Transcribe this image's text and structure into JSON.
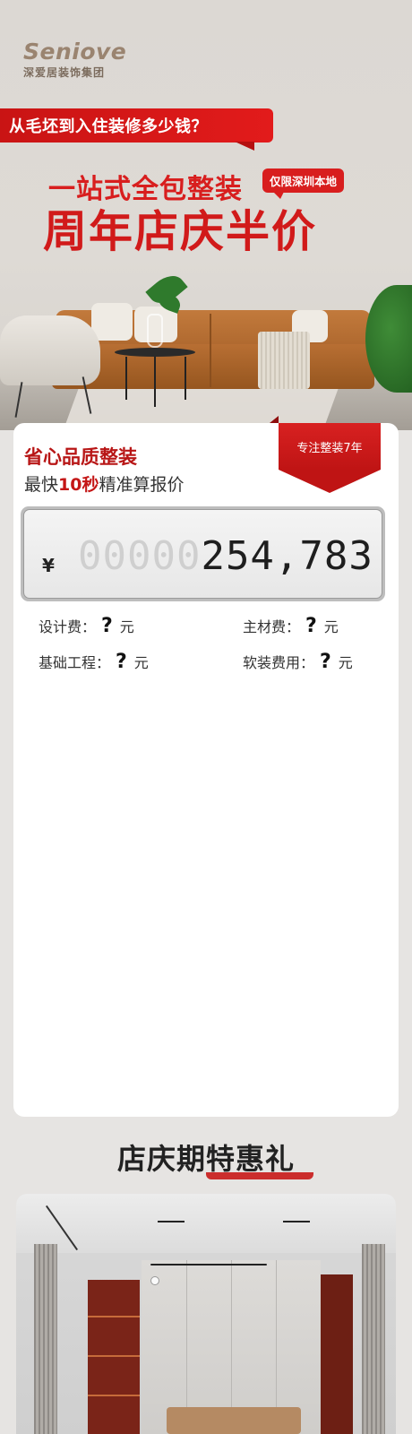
{
  "brand": {
    "name": "Seniove",
    "subtitle": "深爱居装饰集团"
  },
  "hero": {
    "question": "从毛坯到入住装修多少钱？",
    "headline_1": "一站式全包整装",
    "local_tag": "仅限深圳本地",
    "headline_2": "周年店庆半价"
  },
  "calculator": {
    "title": "省心品质整装",
    "subtitle_prefix": "最快",
    "subtitle_highlight": "10秒",
    "subtitle_suffix": "精准算报价",
    "ribbon": "专注整装7年",
    "currency": "¥",
    "placeholder_digits": "00000",
    "amount": "254,783",
    "fees": [
      {
        "label": "设计费：",
        "value": "?",
        "unit": "元"
      },
      {
        "label": "主材费：",
        "value": "?",
        "unit": "元"
      },
      {
        "label": "基础工程：",
        "value": "?",
        "unit": "元"
      },
      {
        "label": "软装费用：",
        "value": "?",
        "unit": "元"
      }
    ]
  },
  "gift": {
    "title_prefix": "店庆期",
    "title_emphasis": "特惠礼"
  },
  "colors": {
    "accent_red": "#d81e1e",
    "brand_brown": "#9a8470",
    "background": "#e6e4e2"
  }
}
